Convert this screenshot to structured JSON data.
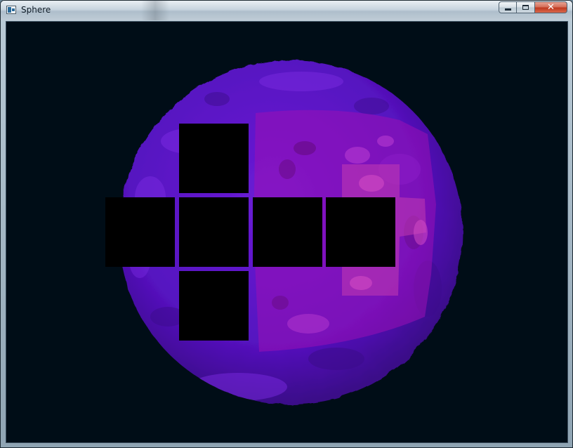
{
  "window": {
    "title": "Sphere",
    "controls": {
      "minimize": "minimize",
      "maximize": "maximize",
      "close": "close"
    }
  },
  "scene": {
    "background_color": "#000d17",
    "sphere_colors": {
      "base": "#5a14c8",
      "dark": "#3c0c8c",
      "light": "#7a2ae0",
      "overlay": "#9a10b4",
      "highlight": "#c23ab0"
    },
    "cube_face_color": "#000000",
    "cube_faces": [
      "top",
      "left",
      "front",
      "right",
      "back",
      "bottom"
    ]
  }
}
